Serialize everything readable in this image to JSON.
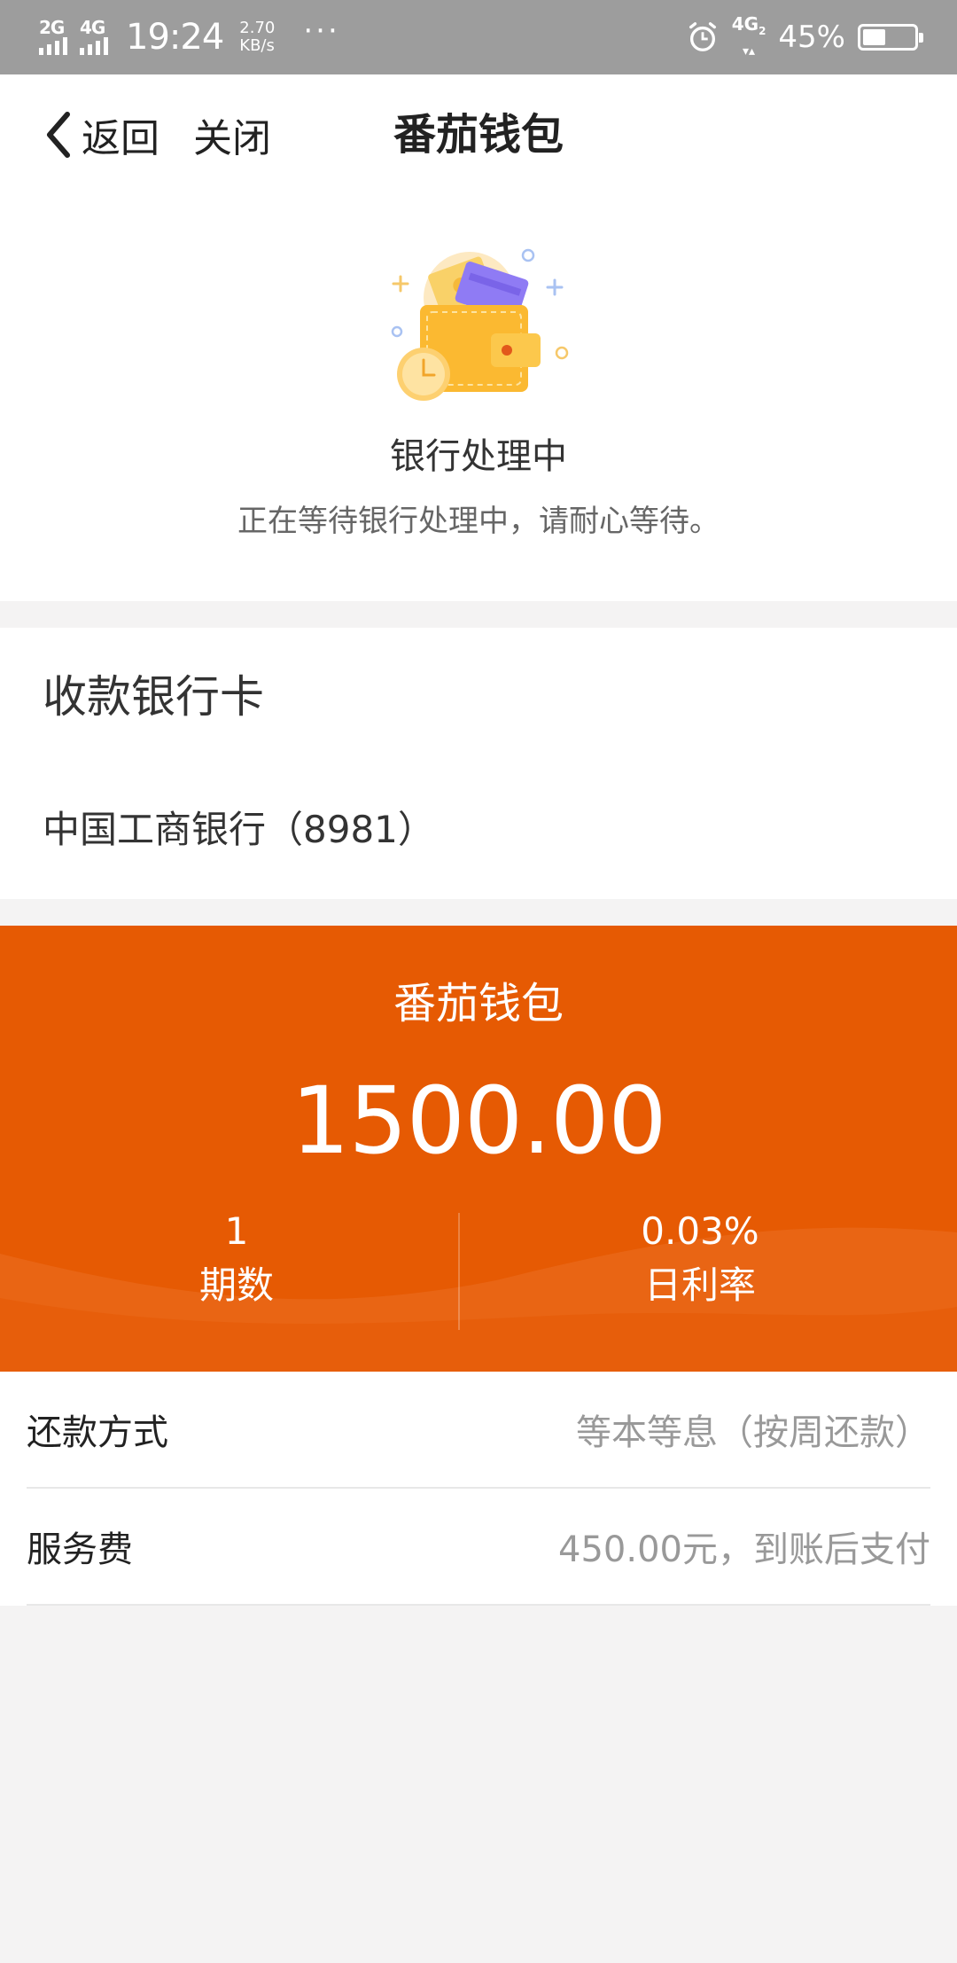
{
  "status_bar": {
    "signal_1": "2G",
    "signal_2": "4G",
    "time": "19:24",
    "speed_value": "2.70",
    "speed_unit": "KB/s",
    "more": "···",
    "network": "4G",
    "network_sub": "2",
    "battery": "45%",
    "battery_level": 0.45
  },
  "nav": {
    "back_label": "返回",
    "close_label": "关闭",
    "title": "番茄钱包"
  },
  "status": {
    "title": "银行处理中",
    "description": "正在等待银行处理中，请耐心等待。"
  },
  "bank": {
    "heading": "收款银行卡",
    "name": "中国工商银行（8981）"
  },
  "loan": {
    "title": "番茄钱包",
    "amount": "1500.00",
    "periods_value": "1",
    "periods_label": "期数",
    "rate_value": "0.03%",
    "rate_label": "日利率"
  },
  "details": [
    {
      "label": "还款方式",
      "value": "等本等息（按周还款）"
    },
    {
      "label": "服务费",
      "value": "450.00元，到账后支付"
    }
  ],
  "colors": {
    "accent": "#e65a03",
    "status_bar": "#9d9d9d",
    "page_bg": "#f4f3f3"
  },
  "icons": [
    "back-chevron-icon",
    "wallet-illustration",
    "alarm-icon",
    "battery-icon"
  ]
}
